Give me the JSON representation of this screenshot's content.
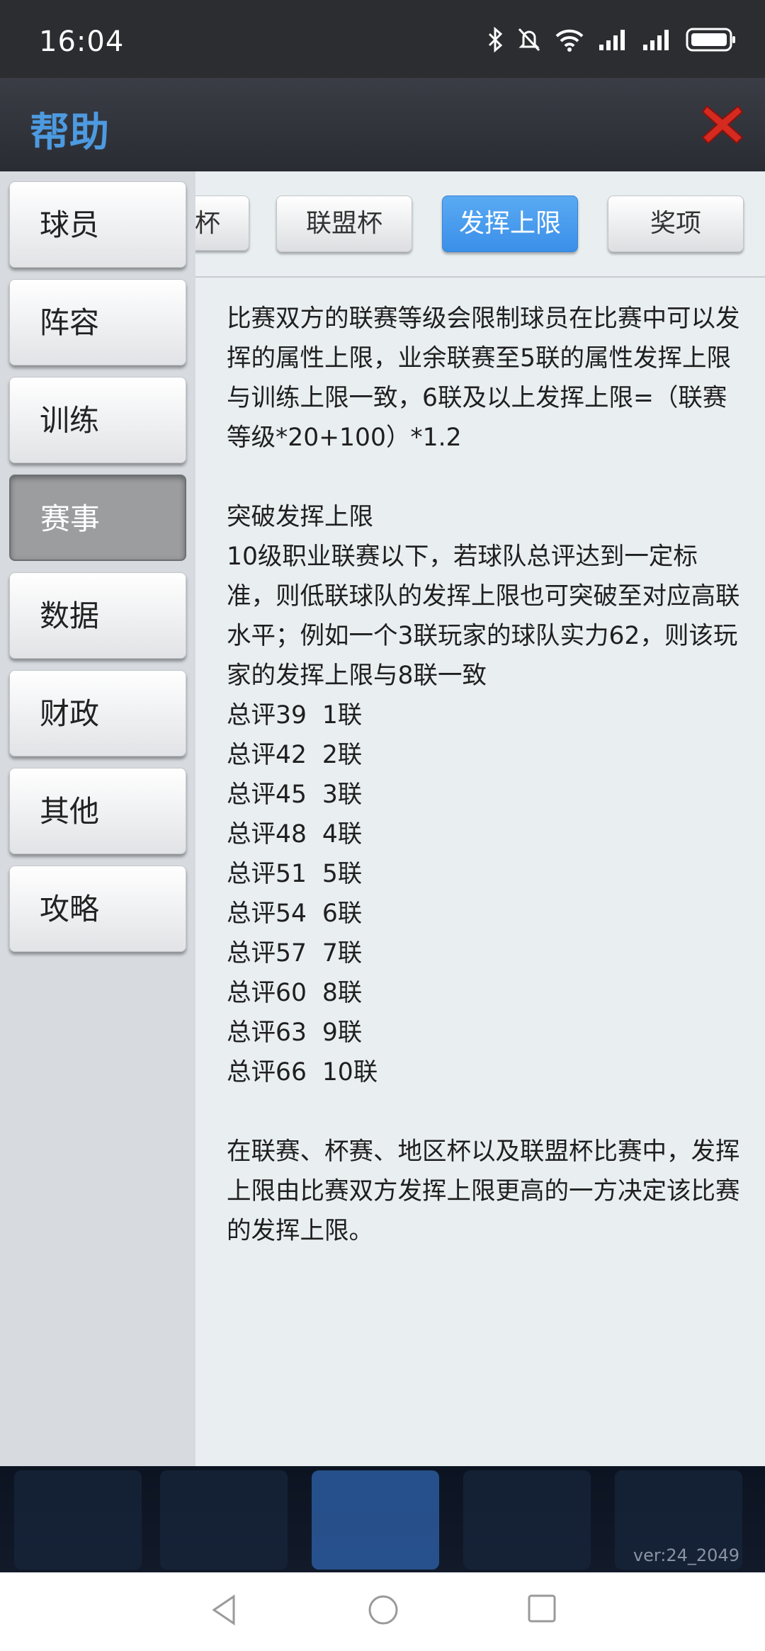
{
  "status": {
    "time": "16:04",
    "icons": [
      "bluetooth-icon",
      "mute-icon",
      "wifi-icon",
      "signal-icon",
      "signal-icon",
      "battery-icon"
    ]
  },
  "header": {
    "title": "帮助",
    "close_icon": "close-icon",
    "title_color": "#4d9ae0"
  },
  "sidebar": {
    "items": [
      {
        "label": "球员"
      },
      {
        "label": "阵容"
      },
      {
        "label": "训练"
      },
      {
        "label": "赛事"
      },
      {
        "label": "数据"
      },
      {
        "label": "财政"
      },
      {
        "label": "其他"
      },
      {
        "label": "攻略"
      }
    ],
    "active": "赛事"
  },
  "tabs": {
    "items": [
      {
        "label": "杯"
      },
      {
        "label": "联盟杯"
      },
      {
        "label": "发挥上限"
      },
      {
        "label": "奖项"
      }
    ],
    "active": "发挥上限",
    "active_color": "#3a8fe8"
  },
  "content": {
    "intro": "比赛双方的联赛等级会限制球员在比赛中可以发挥的属性上限，业余联赛至5联的属性发挥上限与训练上限一致，6联及以上发挥上限=（联赛等级*20+100）*1.2",
    "section_title": "突破发挥上限",
    "section_text": "10级职业联赛以下，若球队总评达到一定标准，则低联球队的发挥上限也可突破至对应高联水平；例如一个3联玩家的球队实力62，则该玩家的发挥上限与8联一致",
    "thresholds": [
      "总评39  1联",
      "总评42  2联",
      "总评45  3联",
      "总评48  4联",
      "总评51  5联",
      "总评54  6联",
      "总评57  7联",
      "总评60  8联",
      "总评63  9联",
      "总评66  10联"
    ],
    "closing": "在联赛、杯赛、地区杯以及联盟杯比赛中，发挥上限由比赛双方发挥上限更高的一方决定该比赛的发挥上限。"
  },
  "footer": {
    "version": "ver:24_2049"
  },
  "navbar": {
    "buttons": [
      "back-icon",
      "home-icon",
      "recents-icon"
    ]
  }
}
